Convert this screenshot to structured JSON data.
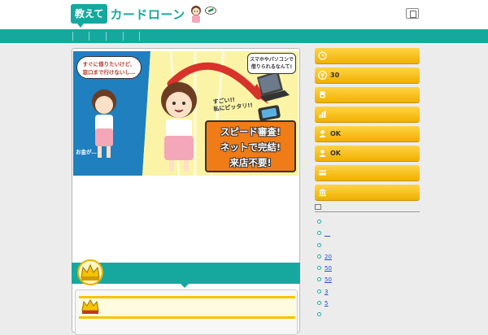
{
  "header": {
    "logo_box": "教えて",
    "logo_text": "カードローン"
  },
  "banner": {
    "bubble_left": [
      "すぐに借りたいけど、",
      "窓口まで行けないし…"
    ],
    "bubble_right": [
      "スマホやパソコンで",
      "借りられるなんて!"
    ],
    "exclaim": [
      "すごい!!",
      "私にピッタリ!!"
    ],
    "mutter": "お金が…",
    "promo_lines": [
      "スピード審査!",
      "ネットで完結!",
      "来店不要!"
    ]
  },
  "sidebar": {
    "buttons": [
      {
        "icon": "clock-icon",
        "label": ""
      },
      {
        "icon": "yen-icon",
        "label": "30"
      },
      {
        "icon": "document-icon",
        "label": ""
      },
      {
        "icon": "chart-icon",
        "label": ""
      },
      {
        "icon": "person-icon",
        "label": "OK"
      },
      {
        "icon": "person-icon",
        "label": "OK"
      },
      {
        "icon": "card-icon",
        "label": ""
      },
      {
        "icon": "bank-icon",
        "label": ""
      }
    ],
    "categories": [
      "",
      "__",
      "",
      "20",
      "50",
      "50",
      "3",
      " 5"
    ]
  },
  "colors": {
    "brand_teal": "#16a89e",
    "button_gold": "#f5c400",
    "promo_orange": "#f07c17"
  }
}
